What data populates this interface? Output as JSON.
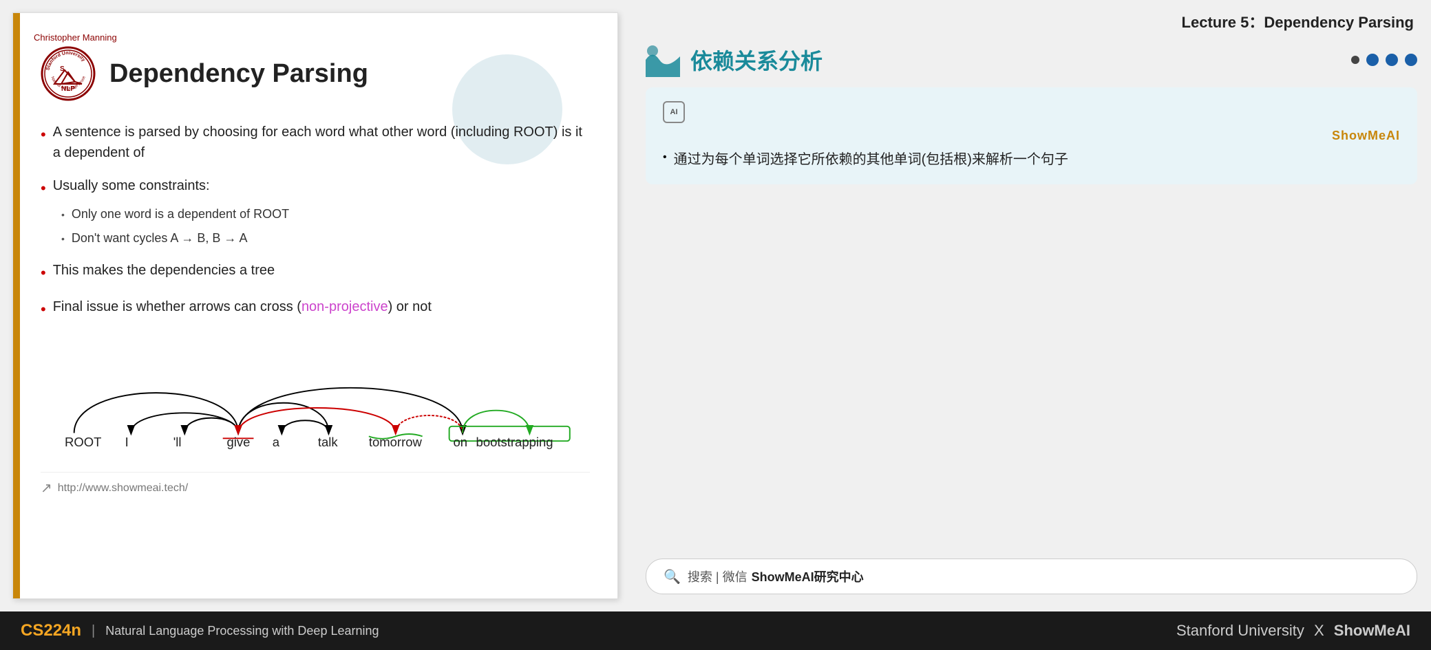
{
  "lecture": {
    "title": "Lecture 5：Dependency Parsing"
  },
  "slide": {
    "author": "Christopher Manning",
    "title": "Dependency Parsing",
    "bullets": [
      {
        "text": "A sentence is parsed by choosing for each word what other word (including ROOT) is it a dependent of"
      },
      {
        "text": "Usually some constraints:",
        "sub": [
          "Only one word is a dependent of ROOT",
          "Don't want cycles A → B, B → A"
        ]
      },
      {
        "text": "This makes the dependencies a tree"
      },
      {
        "text": "Final issue is whether arrows can cross (",
        "highlight": "non-projective",
        "text2": ") or not"
      }
    ],
    "dep_words": [
      "ROOT",
      "I",
      "'ll",
      "give",
      "a",
      "talk",
      "tomorrow",
      "on",
      "bootstrapping"
    ],
    "footer_url": "http://www.showmeai.tech/"
  },
  "card": {
    "title": "依赖关系分析",
    "translation": {
      "label": "ShowMeAI",
      "text": "通过为每个单词选择它所依赖的其他单词(包括根)来解析一个句子"
    }
  },
  "search": {
    "icon": "🔍",
    "text": "搜索 | 微信",
    "brand": "ShowMeAI研究中心"
  },
  "footer": {
    "cs_code": "CS224n",
    "separator": "|",
    "course_desc": "Natural Language Processing with Deep Learning",
    "university": "Stanford University",
    "x": "X",
    "brand": "ShowMeAI"
  }
}
